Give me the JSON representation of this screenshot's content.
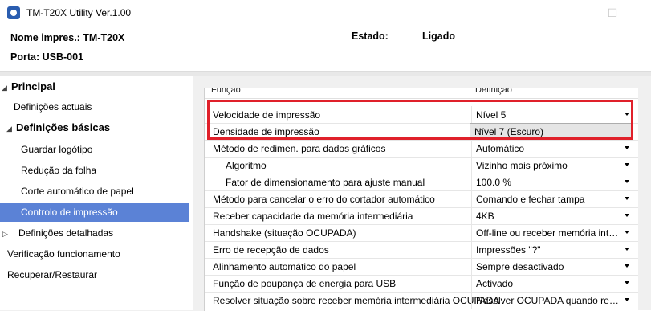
{
  "window": {
    "title": "TM-T20X Utility Ver.1.00",
    "minimize": "—",
    "maximize": "☐"
  },
  "header": {
    "printer_name": "Nome impres.: TM-T20X",
    "port": "Porta: USB-001",
    "status_label": "Estado:",
    "status_value": "Ligado"
  },
  "sidebar": {
    "items": [
      {
        "label": "Principal",
        "level": 0
      },
      {
        "label": "Definições actuais",
        "level": 1
      },
      {
        "label": "Definições básicas",
        "level": 1
      },
      {
        "label": "Guardar logótipo",
        "level": 2
      },
      {
        "label": "Redução da folha",
        "level": 2
      },
      {
        "label": "Corte automático de papel",
        "level": 2
      },
      {
        "label": "Controlo de impressão",
        "level": 2,
        "selected": true
      },
      {
        "label": "Definições detalhadas",
        "level": 1
      },
      {
        "label": "Verificação funcionamento",
        "level": 0
      },
      {
        "label": "Recuperar/Restaurar",
        "level": 0
      }
    ]
  },
  "grid": {
    "header": {
      "function": "Função",
      "setting": "Definição"
    },
    "rows": [
      {
        "function": "Velocidade de impressão",
        "value": "Nível 5"
      },
      {
        "function": "Densidade de impressão",
        "value": "Nível 7 (Escuro)"
      },
      {
        "function": "Método de redimen. para dados gráficos",
        "value": "Automático"
      },
      {
        "function": "Algoritmo",
        "value": "Vizinho mais próximo"
      },
      {
        "function": "Fator de dimensionamento para ajuste manual",
        "value": "100.0 %"
      },
      {
        "function": "Método para cancelar o erro do cortador automático",
        "value": "Comando e fechar tampa"
      },
      {
        "function": "Receber capacidade da memória intermediária",
        "value": "4KB"
      },
      {
        "function": "Handshake (situação OCUPADA)",
        "value": "Off-line ou receber memória intermediária"
      },
      {
        "function": "Erro de recepção de dados",
        "value": "Impressões \"?\""
      },
      {
        "function": "Alinhamento automático do papel",
        "value": "Sempre desactivado"
      },
      {
        "function": "Função de poupança de energia para USB",
        "value": "Activado"
      },
      {
        "function": "Resolver situação sobre receber memória intermediária OCUPADA",
        "value": "Resolver OCUPADA quando receber memória"
      }
    ]
  },
  "colors": {
    "selection": "#5b82d6",
    "highlight_box": "#e0202a"
  }
}
